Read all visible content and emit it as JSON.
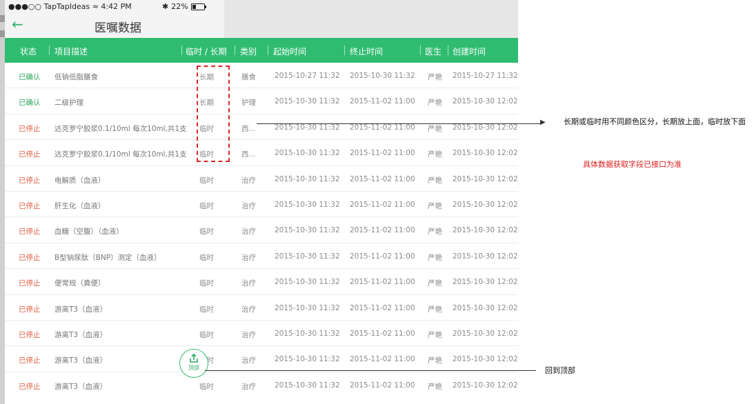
{
  "status_bar": {
    "carrier": "●●●○○ TapTapIdeas",
    "time": "4:42 PM",
    "battery": "22%"
  },
  "nav": {
    "title": "医嘱数据",
    "back_icon": "arrow-left-icon"
  },
  "columns": [
    "状态",
    "项目描述",
    "临时 / 长期",
    "类别",
    "起始时间",
    "终止时间",
    "医生",
    "创建时间"
  ],
  "rows": [
    {
      "status": "已确认",
      "status_type": "ok",
      "desc": "低钠低脂膳食",
      "term": "长期",
      "category": "膳食",
      "start": "2015-10-27 11:32",
      "end": "2015-10-30 11:32",
      "doctor": "严艳",
      "created": "2015-10-27 11:32"
    },
    {
      "status": "已确认",
      "status_type": "ok",
      "desc": "二级护理",
      "term": "长期",
      "category": "护理",
      "start": "2015-10-30 11:32",
      "end": "2015-11-02 11:00",
      "doctor": "严艳",
      "created": "2015-10-30 12:02"
    },
    {
      "status": "已停止",
      "status_type": "stop",
      "desc": "达克罗宁胶浆0.1/10ml 每次10ml,共1支",
      "term": "临时",
      "category": "西...",
      "start": "2015-10-30 11:32",
      "end": "2015-11-02 11:00",
      "doctor": "严艳",
      "created": "2015-10-30 12:02"
    },
    {
      "status": "已停止",
      "status_type": "stop",
      "desc": "达克罗宁胶浆0.1/10ml 每次10ml,共1支",
      "term": "临时",
      "category": "西...",
      "start": "2015-10-30 11:32",
      "end": "2015-11-02 11:00",
      "doctor": "严艳",
      "created": "2015-10-30 12:02"
    },
    {
      "status": "已停止",
      "status_type": "stop",
      "desc": "电解质（血液）",
      "term": "临时",
      "category": "治疗",
      "start": "2015-10-30 11:32",
      "end": "2015-11-02 11:00",
      "doctor": "严艳",
      "created": "2015-10-30 12:02"
    },
    {
      "status": "已停止",
      "status_type": "stop",
      "desc": "肝生化（血液）",
      "term": "临时",
      "category": "治疗",
      "start": "2015-10-30 11:32",
      "end": "2015-11-02 11:00",
      "doctor": "严艳",
      "created": "2015-10-30 12:02"
    },
    {
      "status": "已停止",
      "status_type": "stop",
      "desc": "血糖（空腹）（血液）",
      "term": "临时",
      "category": "治疗",
      "start": "2015-10-30 11:32",
      "end": "2015-11-02 11:00",
      "doctor": "严艳",
      "created": "2015-10-30 12:02"
    },
    {
      "status": "已停止",
      "status_type": "stop",
      "desc": "B型钠尿肽（BNP）测定（血液）",
      "term": "临时",
      "category": "治疗",
      "start": "2015-10-30 11:32",
      "end": "2015-11-02 11:00",
      "doctor": "严艳",
      "created": "2015-10-30 12:02"
    },
    {
      "status": "已停止",
      "status_type": "stop",
      "desc": "便常规（粪便）",
      "term": "临时",
      "category": "治疗",
      "start": "2015-10-30 11:32",
      "end": "2015-11-02 11:00",
      "doctor": "严艳",
      "created": "2015-10-30 12:02"
    },
    {
      "status": "已停止",
      "status_type": "stop",
      "desc": "游离T3（血液）",
      "term": "临时",
      "category": "治疗",
      "start": "2015-10-30 11:32",
      "end": "2015-11-02 11:00",
      "doctor": "严艳",
      "created": "2015-10-30 12:02"
    },
    {
      "status": "已停止",
      "status_type": "stop",
      "desc": "游离T3（血液）",
      "term": "临时",
      "category": "治疗",
      "start": "2015-10-30 11:32",
      "end": "2015-11-02 11:00",
      "doctor": "严艳",
      "created": "2015-10-30 12:02"
    },
    {
      "status": "已停止",
      "status_type": "stop",
      "desc": "游离T3（血液）",
      "term": "临时",
      "category": "治疗",
      "start": "2015-10-30 11:32",
      "end": "2015-11-02 11:00",
      "doctor": "严艳",
      "created": "2015-10-30 12:02"
    },
    {
      "status": "已停止",
      "status_type": "stop",
      "desc": "游离T3（血液）",
      "term": "临时",
      "category": "治疗",
      "start": "2015-10-30 11:32",
      "end": "2015-11-02 11:00",
      "doctor": "严艳",
      "created": "2015-10-30 12:02"
    }
  ],
  "back_to_top": {
    "label": "顶部",
    "icon": "share-upload-icon"
  },
  "annotations": {
    "term_note": "长期或临时用不同颜色区分，长期放上面，临时放下面",
    "api_note": "具体数据获取字段已接口为准",
    "top_note": "回到顶部"
  },
  "colors": {
    "accent": "#2fbc71",
    "confirmed": "#2fa861",
    "stopped": "#e05a3f",
    "annotation_red": "#d8201e"
  }
}
